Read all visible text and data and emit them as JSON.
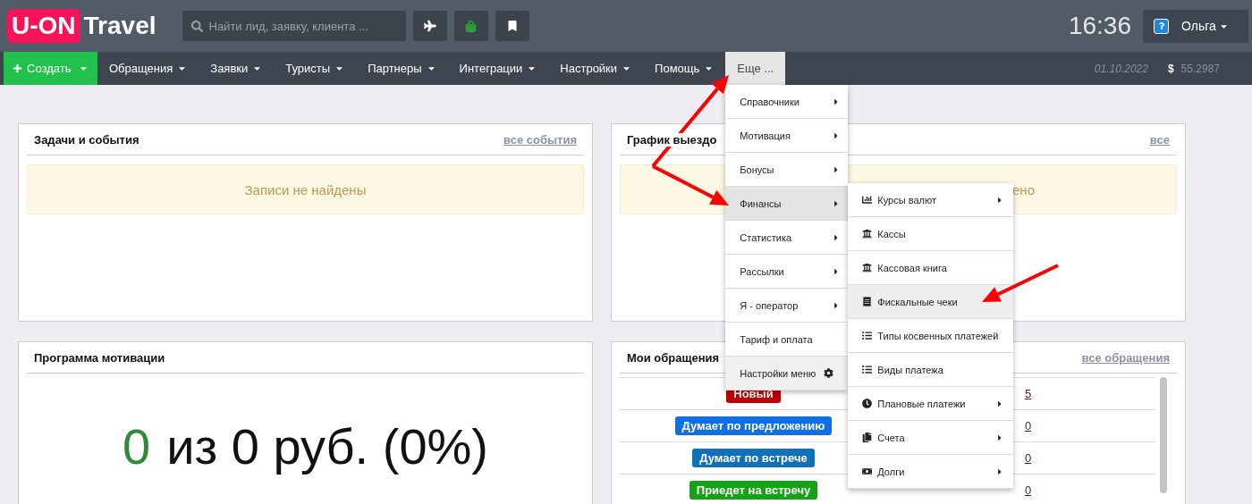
{
  "header": {
    "logo": {
      "brand": "U-ON",
      "text": "Travel"
    },
    "search": {
      "placeholder": "Найти лид, заявку, клиента ..."
    },
    "toolbar_buttons": [
      {
        "kind": "plane"
      },
      {
        "kind": "bag"
      },
      {
        "kind": "bookmark"
      }
    ],
    "time": "16:36",
    "user": {
      "name": "Ольга"
    }
  },
  "nav": {
    "create": "Создать",
    "items": [
      {
        "label": "Обращения",
        "caret": true,
        "selected": false
      },
      {
        "label": "Заявки",
        "caret": true,
        "selected": false
      },
      {
        "label": "Туристы",
        "caret": true,
        "selected": false
      },
      {
        "label": "Партнеры",
        "caret": true,
        "selected": false
      },
      {
        "label": "Интеграции",
        "caret": true,
        "selected": false
      },
      {
        "label": "Настройки",
        "caret": true,
        "selected": false
      },
      {
        "label": "Помощь",
        "caret": true,
        "selected": false
      },
      {
        "label": "Еще ...",
        "caret": false,
        "selected": true
      }
    ],
    "date": "01.10.2022",
    "currency": {
      "symbol": "$",
      "rate": "55.2987"
    }
  },
  "menu": {
    "items": [
      {
        "label": "Справочники",
        "kind": "arrow",
        "selected": false
      },
      {
        "label": "Мотивация",
        "kind": "arrow",
        "selected": false
      },
      {
        "label": "Бонусы",
        "kind": "arrow",
        "selected": false
      },
      {
        "label": "Финансы",
        "kind": "arrow",
        "selected": true
      },
      {
        "label": "Статистика",
        "kind": "arrow",
        "selected": false
      },
      {
        "label": "Рассылки",
        "kind": "arrow",
        "selected": false
      },
      {
        "label": "Я - оператор",
        "kind": "arrow",
        "selected": false
      },
      {
        "label": "Тариф и оплата",
        "kind": "plain",
        "selected": false
      },
      {
        "label": "Настройки меню",
        "kind": "settings",
        "selected": false
      }
    ]
  },
  "submenu": {
    "items": [
      {
        "label": "Курсы валют",
        "kind": "chart",
        "arrow": true,
        "selected": false
      },
      {
        "label": "Кассы",
        "kind": "bank",
        "arrow": false,
        "selected": false
      },
      {
        "label": "Кассовая книга",
        "kind": "bank",
        "arrow": false,
        "selected": false
      },
      {
        "label": "Фискальные чеки",
        "kind": "receipt",
        "arrow": false,
        "selected": true
      },
      {
        "label": "Типы косвенных платежей",
        "kind": "list",
        "arrow": false,
        "selected": false
      },
      {
        "label": "Виды платежа",
        "kind": "list",
        "arrow": false,
        "selected": false
      },
      {
        "label": "Плановые платежи",
        "kind": "clock",
        "arrow": true,
        "selected": false
      },
      {
        "label": "Счета",
        "kind": "copy",
        "arrow": true,
        "selected": false
      },
      {
        "label": "Долги",
        "kind": "money",
        "arrow": true,
        "selected": false
      }
    ]
  },
  "panels": {
    "tasks": {
      "title": "Задачи и события",
      "link": "все события",
      "empty": "Записи не найдены"
    },
    "departures": {
      "title": "График выездо",
      "link": "все",
      "empty": "ено"
    },
    "motivation": {
      "title": "Программа мотивации",
      "amount": "0",
      "rest": "из 0 руб. (0%)"
    },
    "requests": {
      "title": "Мои обращения",
      "link": "все обращения",
      "rows": [
        {
          "status": "Новый",
          "color": "#c00000",
          "count": "5"
        },
        {
          "status": "Думает по предложению",
          "color": "#0f6fe6",
          "count": "0"
        },
        {
          "status": "Думает по встрече",
          "color": "#1070b8",
          "count": "0"
        },
        {
          "status": "Приедет на встречу",
          "color": "#14a314",
          "count": "0"
        }
      ]
    }
  }
}
